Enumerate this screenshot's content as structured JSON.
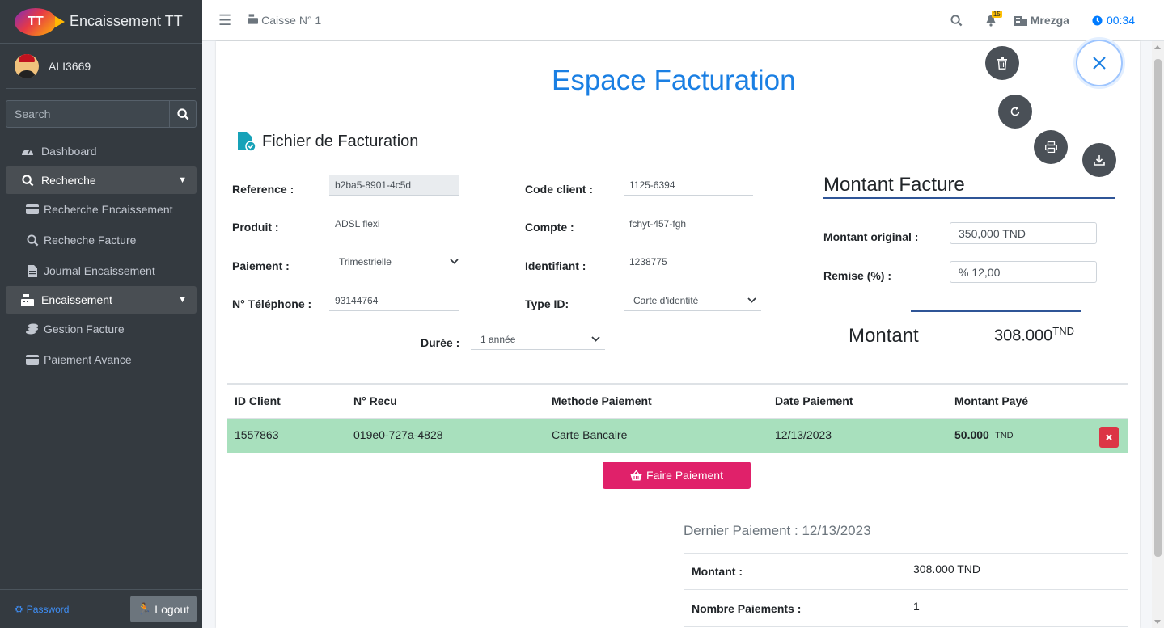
{
  "app": {
    "title": "Encaissement TT",
    "logo_text": "TT"
  },
  "user": {
    "name": "ALI3669"
  },
  "sidebar": {
    "search_placeholder": "Search",
    "items": [
      {
        "label": "Dashboard"
      },
      {
        "label": "Recherche"
      },
      {
        "label": "Recherche Encaissement"
      },
      {
        "label": "Recheche Facture"
      },
      {
        "label": "Journal Encaissement"
      },
      {
        "label": "Encaissement"
      },
      {
        "label": "Gestion Facture"
      },
      {
        "label": "Paiement Avance"
      }
    ],
    "footer": {
      "password": "Password",
      "logout": "Logout"
    }
  },
  "topbar": {
    "caisse": "Caisse N° 1",
    "bell_count": "15",
    "location": "Mrezga",
    "time": "00:34"
  },
  "page": {
    "title": "Espace Facturation",
    "section": "Fichier de Facturation"
  },
  "form": {
    "reference": {
      "label": "Reference :",
      "value": "b2ba5-8901-4c5d"
    },
    "produit": {
      "label": "Produit :",
      "value": "ADSL flexi"
    },
    "paiement": {
      "label": "Paiement :",
      "value": "Trimestrielle"
    },
    "telephone": {
      "label": "N° Téléphone :",
      "value": "93144764"
    },
    "code_client": {
      "label": "Code client :",
      "value": "1125-6394"
    },
    "compte": {
      "label": "Compte :",
      "value": "fchyt-457-fgh"
    },
    "identifiant": {
      "label": "Identifiant :",
      "value": "1238775"
    },
    "type_id": {
      "label": "Type ID:",
      "value": "Carte d'identité"
    },
    "duree": {
      "label": "Durée :",
      "value": "1 année"
    }
  },
  "montant_facture": {
    "title": "Montant Facture",
    "original_label": "Montant original :",
    "original_value": "350,000 TND",
    "remise_label": "Remise (%) :",
    "remise_value": "% 12,00",
    "montant_label": "Montant",
    "montant_value": "308.000",
    "montant_unit": "TND"
  },
  "table": {
    "headers": [
      "ID Client",
      "N° Recu",
      "Methode Paiement",
      "Date Paiement",
      "Montant Payé"
    ],
    "rows": [
      {
        "id_client": "1557863",
        "recu": "019e0-727a-4828",
        "methode": "Carte Bancaire",
        "date": "12/13/2023",
        "montant": "50.000",
        "unit": "TND"
      }
    ]
  },
  "pay_button": "Faire Paiement",
  "dernier_paiement": {
    "title": "Dernier Paiement : 12/13/2023",
    "montant_label": "Montant :",
    "montant_value": "308.000 TND",
    "nombre_label": "Nombre Paiements :",
    "nombre_value": "1"
  }
}
